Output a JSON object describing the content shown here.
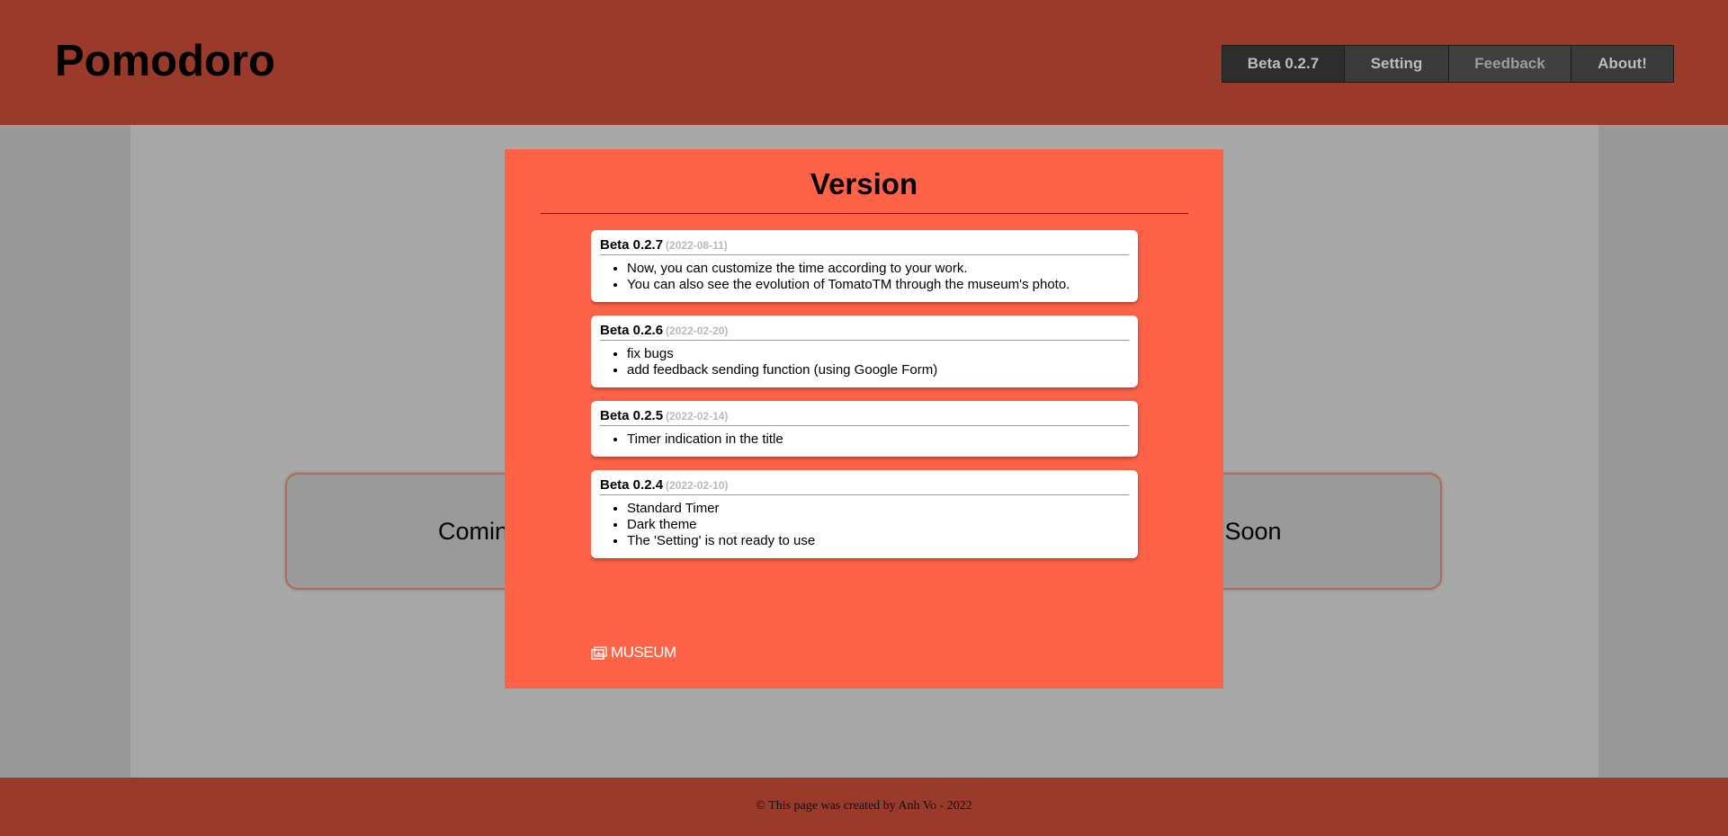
{
  "header": {
    "title": "Pomodoro",
    "nav": [
      {
        "label": "Beta 0.2.7"
      },
      {
        "label": "Setting"
      },
      {
        "label": "Feedback"
      },
      {
        "label": "About!"
      }
    ]
  },
  "main": {
    "coming_left": "Comin",
    "coming_right": "g Soon"
  },
  "modal": {
    "title": "Version",
    "versions": [
      {
        "name": "Beta 0.2.7",
        "date": "(2022-08-11)",
        "notes": [
          "Now, you can customize the time according to your work.",
          "You can also see the evolution of TomatoTM through the museum's photo."
        ]
      },
      {
        "name": "Beta 0.2.6",
        "date": "(2022-02-20)",
        "notes": [
          "fix bugs",
          "add feedback sending function (using Google Form)"
        ]
      },
      {
        "name": "Beta 0.2.5",
        "date": "(2022-02-14)",
        "notes": [
          "Timer indication in the title"
        ]
      },
      {
        "name": "Beta 0.2.4",
        "date": "(2022-02-10)",
        "notes": [
          "Standard Timer",
          "Dark theme",
          "The 'Setting' is not ready to use"
        ]
      }
    ],
    "museum_label": "MUSEUM"
  },
  "footer": {
    "copyright_symbol": "©",
    "text": "This page was created by Anh Vo - 2022"
  }
}
